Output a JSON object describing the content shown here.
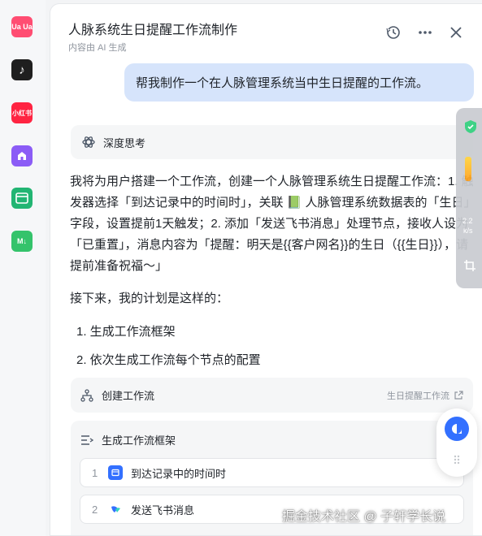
{
  "left_rail": {
    "items": [
      {
        "label": "Ua Ua",
        "color": "#ff4d72",
        "icon": "app-logo-icon"
      },
      {
        "label": "♪",
        "color": "#1f1f1f",
        "icon": "tiktok-icon"
      },
      {
        "label": "小红书",
        "color": "#ff2442",
        "icon": "xiaohongshu-icon"
      },
      {
        "label": "",
        "color": "#8b5cf6",
        "icon": "house-icon"
      },
      {
        "label": "",
        "color": "#22b573",
        "icon": "calendar-icon"
      },
      {
        "label": "M↓",
        "color": "#34c36b",
        "icon": "markdown-icon"
      }
    ]
  },
  "header": {
    "title": "人脉系统生日提醒工作流制作",
    "subtitle": "内容由 AI 生成",
    "buttons": [
      "history-icon",
      "more-icon",
      "close-icon"
    ]
  },
  "conversation": {
    "user_message": "帮我制作一个在人脉管理系统当中生日提醒的工作流。",
    "thinking_label": "深度思考",
    "answer_text": "我将为用户搭建一个工作流，创建一个人脉管理系统生日提醒工作流：1. 触发器选择「到达记录中的时间时」，关联 📗 人脉管理系统数据表的「生日」字段，设置提前1天触发；2. 添加「发送飞书消息」处理节点，接收人设为「已重置」，消息内容为「提醒：明天是{{客户网名}}的生日（{{生日}}），请提前准备祝福～」",
    "plan_intro": "接下来，我的计划是这样的：",
    "plan_items": [
      "1.  生成工作流框架",
      "2.  依次生成工作流每个节点的配置"
    ]
  },
  "workflow_card": {
    "label": "创建工作流",
    "link_text": "生日提醒工作流"
  },
  "generate_card": {
    "label": "生成工作流框架",
    "nodes": [
      {
        "num": "1",
        "label": "到达记录中的时间时",
        "icon_color": "#3370ff"
      },
      {
        "num": "2",
        "label": "发送飞书消息",
        "icon_color": "#ffffff"
      }
    ]
  },
  "floating_toolbar": {
    "texts": [
      "2.2",
      "k/s"
    ]
  },
  "watermark": "掘金技术社区 @ 子轩学长说"
}
